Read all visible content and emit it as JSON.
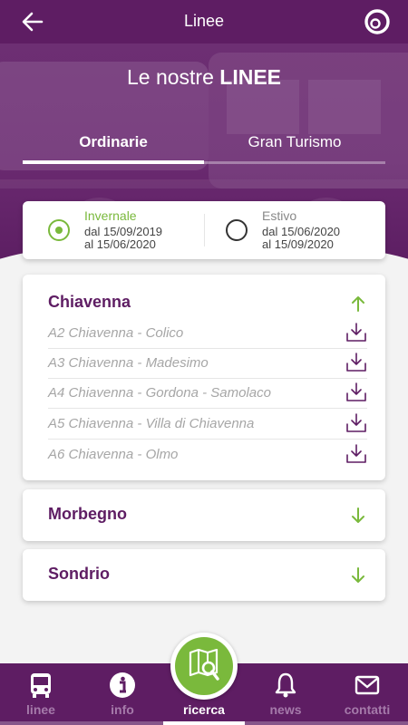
{
  "header": {
    "title": "Linee",
    "back_icon": "back-arrow-icon",
    "logo_icon": "brand-logo-icon"
  },
  "hero": {
    "title_prefix": "Le nostre ",
    "title_bold": "LINEE"
  },
  "tabs": [
    {
      "label": "Ordinarie",
      "active": true
    },
    {
      "label": "Gran Turismo",
      "active": false
    }
  ],
  "seasons": [
    {
      "name": "Invernale",
      "from": "dal 15/09/2019",
      "to": "al 15/06/2020",
      "selected": true
    },
    {
      "name": "Estivo",
      "from": "dal 15/06/2020",
      "to": "al 15/09/2020",
      "selected": false
    }
  ],
  "groups": [
    {
      "name": "Chiavenna",
      "expanded": true,
      "lines": [
        "A2 Chiavenna - Colico",
        "A3 Chiavenna - Madesimo",
        "A4 Chiavenna - Gordona - Samolaco",
        "A5 Chiavenna - Villa di Chiavenna",
        "A6 Chiavenna - Olmo"
      ]
    },
    {
      "name": "Morbegno",
      "expanded": false,
      "lines": []
    },
    {
      "name": "Sondrio",
      "expanded": false,
      "lines": []
    }
  ],
  "nav": [
    {
      "label": "linee",
      "icon": "bus-icon",
      "active": false
    },
    {
      "label": "info",
      "icon": "info-icon",
      "active": false
    },
    {
      "label": "ricerca",
      "icon": "map-search-icon",
      "active": true
    },
    {
      "label": "news",
      "icon": "bell-icon",
      "active": false
    },
    {
      "label": "contatti",
      "icon": "mail-icon",
      "active": false
    }
  ],
  "colors": {
    "primary": "#5e1d63",
    "accent": "#7ab93c",
    "muted_text": "#a6a6a6"
  }
}
